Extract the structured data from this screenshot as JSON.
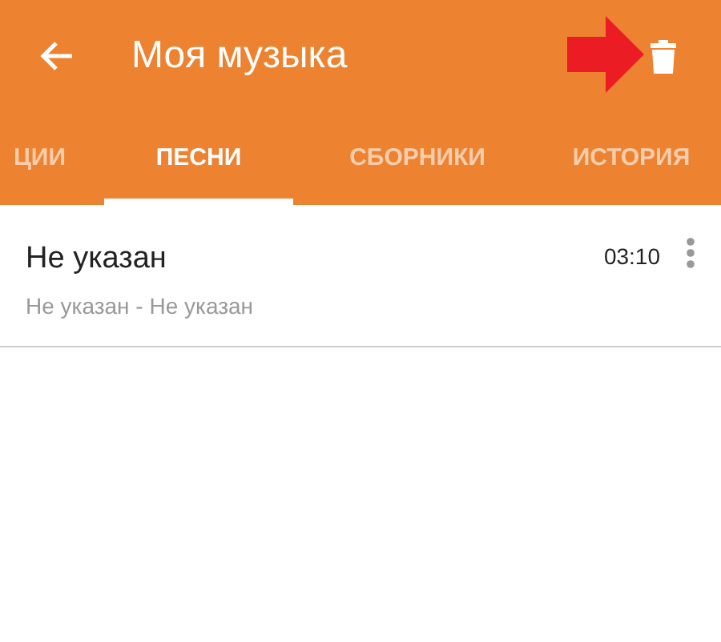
{
  "toolbar": {
    "title": "Моя музыка"
  },
  "tabs": [
    {
      "label": "ЦИИ",
      "selected": false
    },
    {
      "label": "ПЕСНИ",
      "selected": true
    },
    {
      "label": "СБОРНИКИ",
      "selected": false
    },
    {
      "label": "ИСТОРИЯ",
      "selected": false
    }
  ],
  "songs": [
    {
      "title": "Не указан",
      "subtitle": "Не указан - Не указан",
      "duration": "03:10"
    }
  ]
}
